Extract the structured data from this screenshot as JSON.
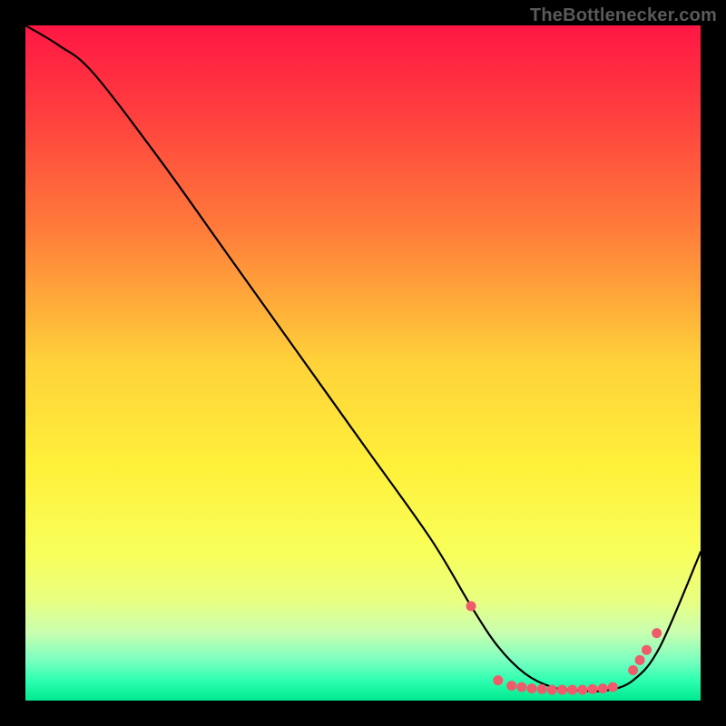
{
  "attribution": "TheBottlenecker.com",
  "chart_data": {
    "type": "line",
    "title": "",
    "xlabel": "",
    "ylabel": "",
    "xlim": [
      0,
      100
    ],
    "ylim": [
      0,
      100
    ],
    "gradient_stops": [
      {
        "offset": 0,
        "color": "#ff1744"
      },
      {
        "offset": 12,
        "color": "#ff3b3f"
      },
      {
        "offset": 30,
        "color": "#ff7b3a"
      },
      {
        "offset": 50,
        "color": "#ffd23a"
      },
      {
        "offset": 65,
        "color": "#fff03a"
      },
      {
        "offset": 78,
        "color": "#f8ff5a"
      },
      {
        "offset": 85,
        "color": "#eaff80"
      },
      {
        "offset": 90,
        "color": "#c8ffb0"
      },
      {
        "offset": 94,
        "color": "#7affc0"
      },
      {
        "offset": 97,
        "color": "#2effb0"
      },
      {
        "offset": 100,
        "color": "#00e890"
      }
    ],
    "series": [
      {
        "name": "bottleneck-curve",
        "x": [
          0,
          5,
          10,
          20,
          30,
          40,
          50,
          60,
          66,
          70,
          74,
          78,
          82,
          86,
          90,
          94,
          100
        ],
        "y": [
          100,
          97,
          93,
          80,
          66,
          52,
          38,
          24,
          14,
          8,
          4,
          2,
          1.5,
          1.5,
          3,
          8,
          22
        ]
      }
    ],
    "markers": {
      "name": "highlighted-points",
      "color": "#ef5b6a",
      "points": [
        {
          "x": 66,
          "y": 14
        },
        {
          "x": 70,
          "y": 3
        },
        {
          "x": 72,
          "y": 2.2
        },
        {
          "x": 73.5,
          "y": 2
        },
        {
          "x": 75,
          "y": 1.8
        },
        {
          "x": 76.5,
          "y": 1.7
        },
        {
          "x": 78,
          "y": 1.6
        },
        {
          "x": 79.5,
          "y": 1.6
        },
        {
          "x": 81,
          "y": 1.6
        },
        {
          "x": 82.5,
          "y": 1.6
        },
        {
          "x": 84,
          "y": 1.7
        },
        {
          "x": 85.5,
          "y": 1.8
        },
        {
          "x": 87,
          "y": 2
        },
        {
          "x": 90,
          "y": 4.5
        },
        {
          "x": 91,
          "y": 6
        },
        {
          "x": 92,
          "y": 7.5
        },
        {
          "x": 93.5,
          "y": 10
        }
      ]
    }
  }
}
